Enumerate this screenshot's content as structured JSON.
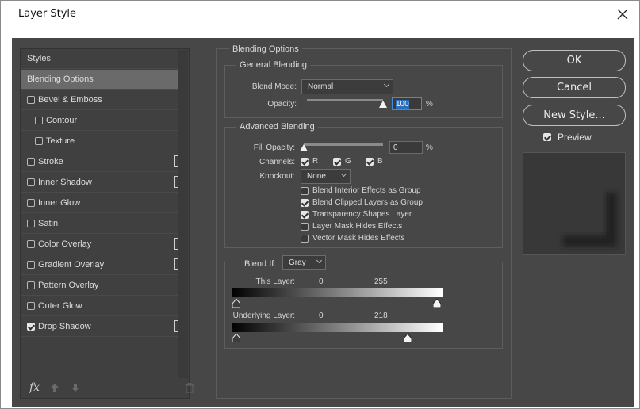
{
  "window": {
    "title": "Layer Style"
  },
  "styles_panel": {
    "items": [
      {
        "label": "Styles",
        "indent": 0,
        "checkbox": null,
        "plus": false,
        "selected": false
      },
      {
        "label": "Blending Options",
        "indent": 0,
        "checkbox": null,
        "plus": false,
        "selected": true
      },
      {
        "label": "Bevel & Emboss",
        "indent": 0,
        "checkbox": false,
        "plus": false,
        "selected": false
      },
      {
        "label": "Contour",
        "indent": 1,
        "checkbox": false,
        "plus": false,
        "selected": false
      },
      {
        "label": "Texture",
        "indent": 1,
        "checkbox": false,
        "plus": false,
        "selected": false
      },
      {
        "label": "Stroke",
        "indent": 0,
        "checkbox": false,
        "plus": true,
        "selected": false
      },
      {
        "label": "Inner Shadow",
        "indent": 0,
        "checkbox": false,
        "plus": true,
        "selected": false
      },
      {
        "label": "Inner Glow",
        "indent": 0,
        "checkbox": false,
        "plus": false,
        "selected": false
      },
      {
        "label": "Satin",
        "indent": 0,
        "checkbox": false,
        "plus": false,
        "selected": false
      },
      {
        "label": "Color Overlay",
        "indent": 0,
        "checkbox": false,
        "plus": true,
        "selected": false
      },
      {
        "label": "Gradient Overlay",
        "indent": 0,
        "checkbox": false,
        "plus": true,
        "selected": false
      },
      {
        "label": "Pattern Overlay",
        "indent": 0,
        "checkbox": false,
        "plus": false,
        "selected": false
      },
      {
        "label": "Outer Glow",
        "indent": 0,
        "checkbox": false,
        "plus": false,
        "selected": false
      },
      {
        "label": "Drop Shadow",
        "indent": 0,
        "checkbox": true,
        "plus": true,
        "selected": false
      }
    ],
    "footer_icons": [
      "fx-icon",
      "arrow-up-icon",
      "arrow-down-icon",
      "trash-icon"
    ],
    "fx_label": "fx"
  },
  "blending": {
    "section_title": "Blending Options",
    "general": {
      "title": "General Blending",
      "blend_mode_label": "Blend Mode:",
      "blend_mode_value": "Normal",
      "opacity_label": "Opacity:",
      "opacity_value": "100",
      "opacity_unit": "%",
      "opacity_level": 1.0
    },
    "advanced": {
      "title": "Advanced Blending",
      "fill_opacity_label": "Fill Opacity:",
      "fill_opacity_value": "0",
      "fill_opacity_unit": "%",
      "fill_opacity_level": 0.0,
      "channels_label": "Channels:",
      "channel_r": "R",
      "channel_g": "G",
      "channel_b": "B",
      "knockout_label": "Knockout:",
      "knockout_value": "None",
      "options": [
        {
          "label": "Blend Interior Effects as Group",
          "checked": false
        },
        {
          "label": "Blend Clipped Layers as Group",
          "checked": true
        },
        {
          "label": "Transparency Shapes Layer",
          "checked": true
        },
        {
          "label": "Layer Mask Hides Effects",
          "checked": false
        },
        {
          "label": "Vector Mask Hides Effects",
          "checked": false
        }
      ]
    },
    "blend_if": {
      "label": "Blend If:",
      "value": "Gray",
      "this_layer_label": "This Layer:",
      "this_layer_low": "0",
      "this_layer_high": "255",
      "underlying_label": "Underlying Layer:",
      "underlying_low": "0",
      "underlying_high": "218"
    }
  },
  "buttons": {
    "ok": "OK",
    "cancel": "Cancel",
    "new_style": "New Style...",
    "preview_label": "Preview",
    "preview_checked": true
  }
}
